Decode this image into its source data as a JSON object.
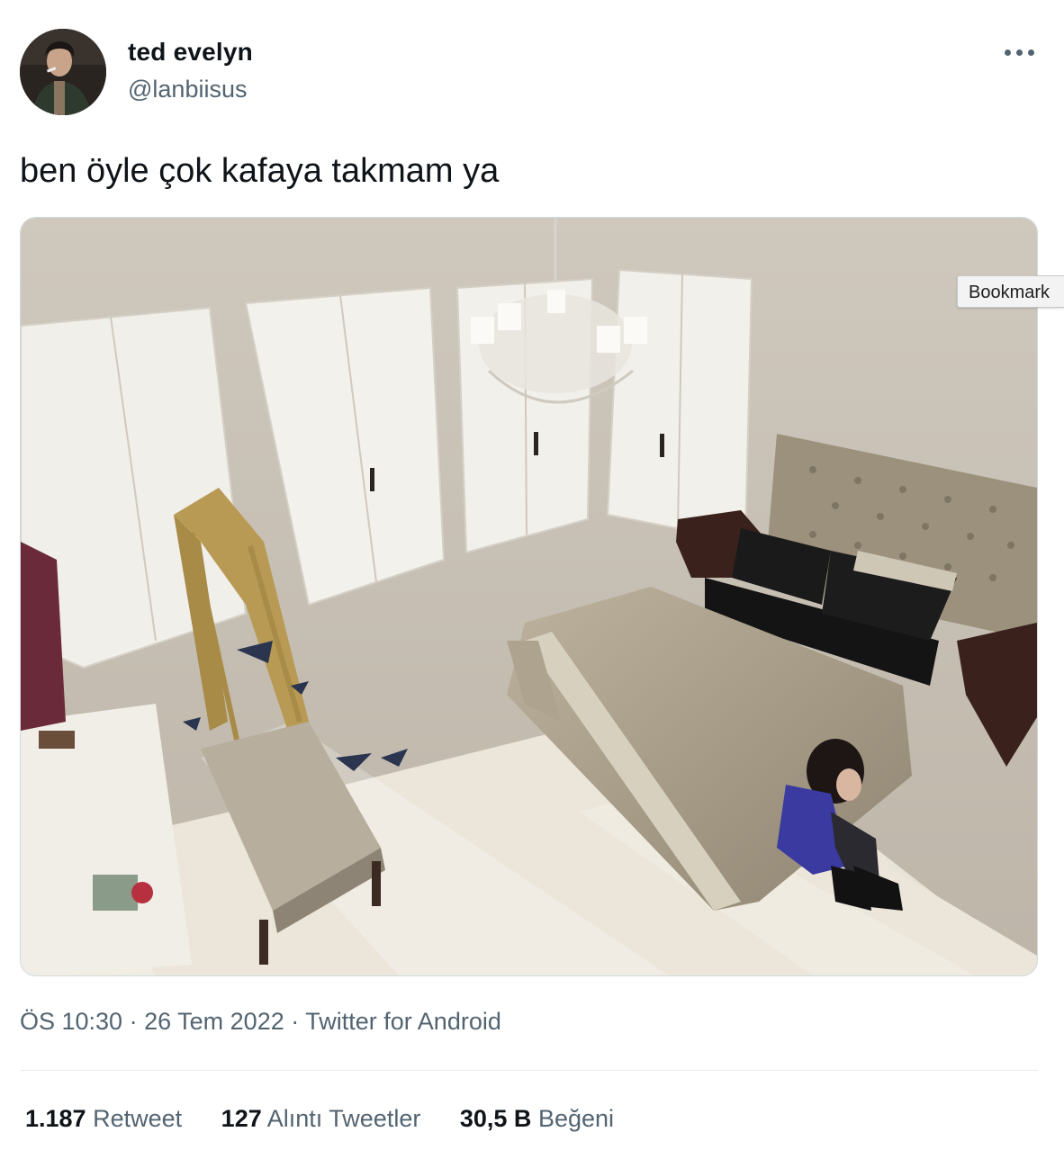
{
  "tweet": {
    "author": {
      "display_name": "ted evelyn",
      "handle": "@lanbiisus"
    },
    "text": "ben öyle çok kafaya takmam ya",
    "media": {
      "alt": "Photo of a white bedroom with a large tufted headboard bed, a chandelier, a broken gilded mirror with shards on the floor, and a woman in a purple dress sitting on the floor beside the bed"
    },
    "meta": {
      "time": "ÖS 10:30",
      "separator": "·",
      "date": "26 Tem 2022",
      "source": "Twitter for Android"
    },
    "stats": {
      "retweets_count": "1.187",
      "retweets_label": "Retweet",
      "quotes_count": "127",
      "quotes_label": "Alıntı Tweetler",
      "likes_count": "30,5 B",
      "likes_label": "Beğeni"
    }
  },
  "overlay": {
    "bookmark_label": "Bookmark"
  },
  "icons": {
    "more": "more-dots-icon"
  },
  "colors": {
    "text_primary": "#0f1419",
    "text_secondary": "#536471",
    "border": "#cfd9de"
  }
}
